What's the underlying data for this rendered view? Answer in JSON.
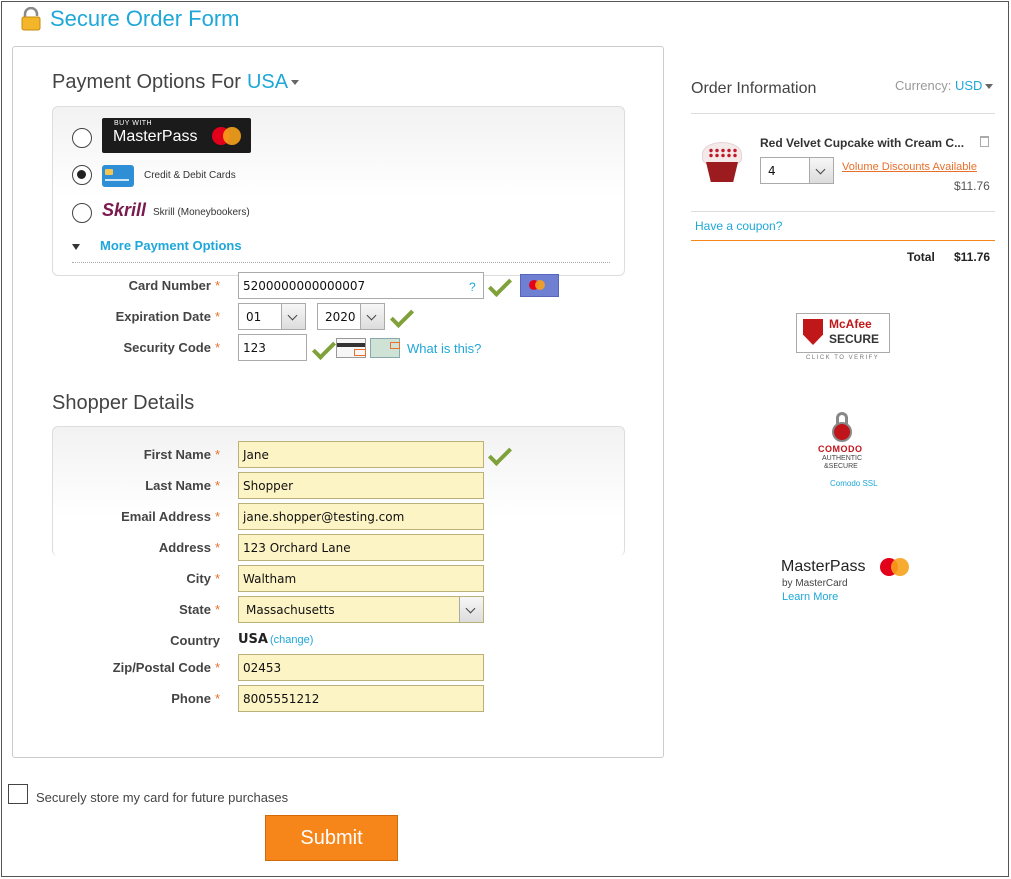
{
  "page_title": "Secure Order Form",
  "payment": {
    "heading": "Payment Options For",
    "country": "USA",
    "options": [
      {
        "id": "masterpass",
        "label_small": "BUY WITH",
        "label_big": "MasterPass",
        "checked": false
      },
      {
        "id": "card",
        "label": "Credit & Debit Cards",
        "checked": true
      },
      {
        "id": "skrill",
        "logo": "Skrill",
        "label": "Skrill (Moneybookers)",
        "checked": false
      }
    ],
    "more_options": "More Payment Options",
    "card_number_label": "Card Number",
    "card_number": "5200000000000007",
    "help_icon": "?",
    "expiration_label": "Expiration Date",
    "exp_month": "01",
    "exp_year": "2020",
    "security_label": "Security Code",
    "security_code": "123",
    "what_is_this": "What is this?",
    "required_mark": "*"
  },
  "shopper": {
    "heading": "Shopper Details",
    "first_name_label": "First Name",
    "first_name": "Jane",
    "last_name_label": "Last Name",
    "last_name": "Shopper",
    "email_label": "Email Address",
    "email": "jane.shopper@testing.com",
    "address_label": "Address",
    "address": "123 Orchard Lane",
    "city_label": "City",
    "city": "Waltham",
    "state_label": "State",
    "state": "Massachusetts",
    "country_label": "Country",
    "country": "USA",
    "change_link": "(change)",
    "zip_label": "Zip/Postal Code",
    "zip": "02453",
    "phone_label": "Phone",
    "phone": "8005551212"
  },
  "store_card_label": "Securely store my card for future purchases",
  "store_card_checked": false,
  "submit_label": "Submit",
  "order": {
    "title": "Order Information",
    "currency_label": "Currency:",
    "currency": "USD",
    "item_name": "Red Velvet Cupcake with Cream C...",
    "quantity": "4",
    "volume_discounts": "Volume Discounts Available",
    "item_price": "$11.76",
    "coupon_link": "Have a coupon?",
    "total_label": "Total",
    "total_value": "$11.76"
  },
  "badges": {
    "mcafee_name": "McAfee",
    "mcafee_secure": "SECURE",
    "mcafee_verify": "CLICK TO VERIFY",
    "comodo_name": "COMODO",
    "comodo_sub1": "AUTHENTIC",
    "comodo_sub2": "&SECURE",
    "comodo_ssl": "Comodo SSL",
    "masterpass_name": "MasterPass",
    "masterpass_by": "by MasterCard",
    "masterpass_learn": "Learn More"
  },
  "colors": {
    "accent_blue": "#1ea7d9",
    "orange": "#f7861a",
    "field_yellow": "#fdf4c5",
    "check_green": "#7fa13a"
  }
}
